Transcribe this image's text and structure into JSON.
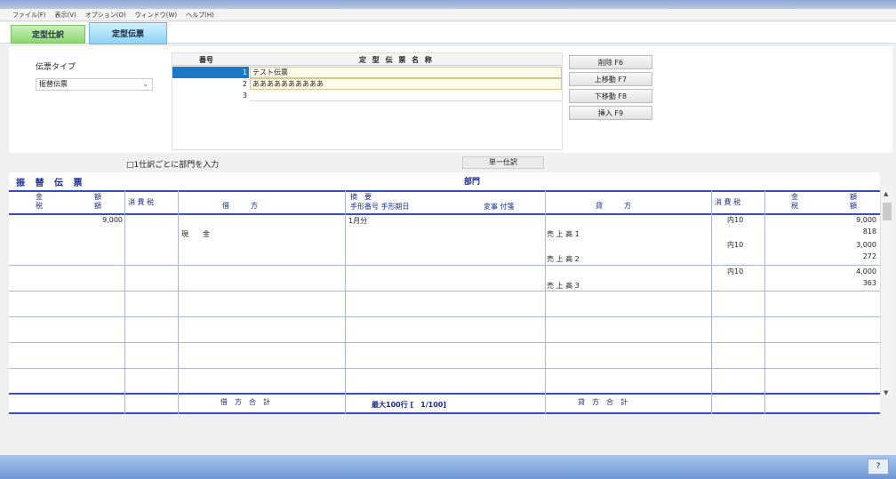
{
  "menu": [
    "ファイル(F)",
    "表示(V)",
    "オプション(O)",
    "ウィンドウ(W)",
    "ヘルプ(H)"
  ],
  "tabs": [
    {
      "label": "定型仕訳"
    },
    {
      "label": "定型伝票"
    }
  ],
  "voucher_type": {
    "label": "伝票タイプ",
    "selected": "振替伝票"
  },
  "template_list": {
    "headers": {
      "number": "番号",
      "name": "定 型 伝 票 名 称"
    },
    "rows": [
      {
        "number": "1",
        "name": "テスト伝票"
      },
      {
        "number": "2",
        "name": "ああああああああああ"
      },
      {
        "number": "3",
        "name": ""
      }
    ]
  },
  "buttons": {
    "delete": "削除 F6",
    "move_up": "上移動 F7",
    "move_down": "下移動 F8",
    "insert": "挿入 F9"
  },
  "options": {
    "dept_per_entry": "□1仕訳ごとに部門を入力",
    "single_entry": "単一仕訳"
  },
  "voucher": {
    "title": "振 替 伝 票",
    "dept_label": "部門",
    "headers": {
      "amount_l1": "金",
      "amount_l2": "額",
      "tax_l": "税",
      "consumption_tax": "消 費 税",
      "debit": "借　　　方",
      "summary": "摘　要",
      "bill_info": "手形番号 手形期日",
      "transfer": "変事 付箋",
      "credit": "貸　　　方"
    },
    "rows": [
      {
        "debit_amount": "9,000",
        "debit_account": "現　　金",
        "summary": "1月分",
        "credit_account": "売 上 高 1",
        "tax_code": "内10",
        "credit_amount": "9,000",
        "credit_tax": "818"
      },
      {
        "debit_amount": "",
        "debit_account": "",
        "summary": "",
        "credit_account": "売 上 高 2",
        "tax_code": "内10",
        "credit_amount": "3,000",
        "credit_tax": "272"
      },
      {
        "debit_amount": "",
        "debit_account": "",
        "summary": "",
        "credit_account": "売 上 高 3",
        "tax_code": "内10",
        "credit_amount": "4,000",
        "credit_tax": "363"
      }
    ],
    "footer": {
      "debit_total": "借　方　合　計",
      "rows_info": "最大100行 [　1/100]",
      "credit_total": "貸　方　合　計"
    }
  }
}
